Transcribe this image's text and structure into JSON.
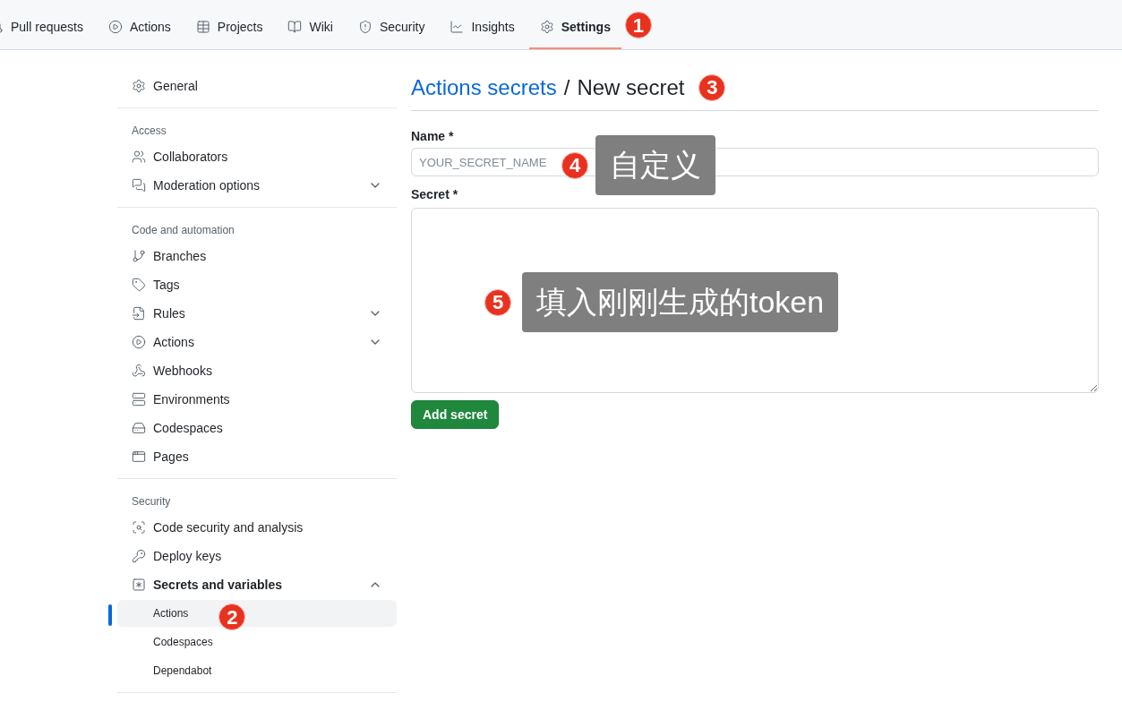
{
  "nav": [
    {
      "label": "Pull requests",
      "selected": false
    },
    {
      "label": "Actions",
      "selected": false
    },
    {
      "label": "Projects",
      "selected": false
    },
    {
      "label": "Wiki",
      "selected": false
    },
    {
      "label": "Security",
      "selected": false
    },
    {
      "label": "Insights",
      "selected": false
    },
    {
      "label": "Settings",
      "selected": true
    }
  ],
  "sidebar": {
    "sections": [
      {
        "items": [
          {
            "label": "General",
            "selected": false
          }
        ]
      },
      {
        "heading": "Access",
        "items": [
          {
            "label": "Collaborators",
            "selected": false
          },
          {
            "label": "Moderation options",
            "selected": false,
            "expanded": false
          }
        ]
      },
      {
        "heading": "Code and automation",
        "items": [
          {
            "label": "Branches",
            "selected": false
          },
          {
            "label": "Tags",
            "selected": false
          },
          {
            "label": "Rules",
            "selected": false,
            "expanded": false
          },
          {
            "label": "Actions",
            "selected": false,
            "expanded": false
          },
          {
            "label": "Webhooks",
            "selected": false
          },
          {
            "label": "Environments",
            "selected": false
          },
          {
            "label": "Codespaces",
            "selected": false
          },
          {
            "label": "Pages",
            "selected": false
          }
        ]
      },
      {
        "heading": "Security",
        "items": [
          {
            "label": "Code security and analysis",
            "selected": false
          },
          {
            "label": "Deploy keys",
            "selected": false
          },
          {
            "label": "Secrets and variables",
            "selected": false,
            "expanded": true,
            "children": [
              {
                "label": "Actions",
                "selected": true
              },
              {
                "label": "Codespaces",
                "selected": false
              },
              {
                "label": "Dependabot",
                "selected": false
              }
            ]
          }
        ]
      }
    ]
  },
  "main": {
    "breadcrumb_link": "Actions secrets",
    "separator": "/",
    "title": "New secret",
    "name_label": "Name *",
    "name_placeholder": "YOUR_SECRET_NAME",
    "secret_label": "Secret *",
    "submit": "Add secret"
  },
  "annotations": [
    {
      "number": "1"
    },
    {
      "number": "2"
    },
    {
      "number": "3"
    },
    {
      "number": "4",
      "callout": "自定义"
    },
    {
      "number": "5",
      "callout": "填入刚刚生成的token"
    }
  ]
}
